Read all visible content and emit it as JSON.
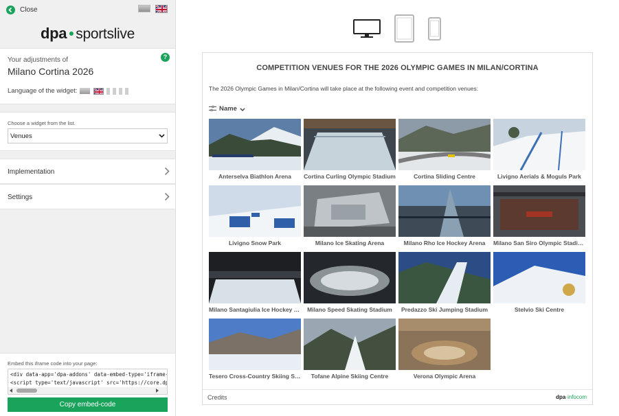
{
  "sidebar": {
    "close_label": "Close",
    "flags": [
      "flag-grey-icon",
      "flag-uk-icon"
    ],
    "logo": {
      "dpa": "dpa",
      "dot": "•",
      "brand": "sportslive"
    },
    "adjustments_label": "Your adjustments of",
    "adjustments_title": "Milano Cortina 2026",
    "help_icon": "?",
    "language_label": "Language of the widget:",
    "widget_select_label": "Choose a widget from the list.",
    "widget_select_value": "Venues",
    "accordions": [
      {
        "label": "Implementation"
      },
      {
        "label": "Settings"
      }
    ],
    "embed_label": "Embed this iframe code into your page:",
    "embed_code_lines": [
      "<div data-app='dpa-addons' data-embed-type='iframe-dyn",
      "<script type='text/javascript' src='https://core.dpa-infocom"
    ],
    "copy_button": "Copy embed-code"
  },
  "devices": [
    "desktop-icon",
    "tablet-icon",
    "phone-icon"
  ],
  "widget": {
    "title": "COMPETITION VENUES FOR THE 2026 OLYMPIC GAMES IN MILAN/CORTINA",
    "intro": "The 2026 Olympic Games in Milan/Cortina will take place at the following event and competition venues:",
    "sort_label": "Name",
    "venues": [
      {
        "name": "Anterselva Biathlon Arena"
      },
      {
        "name": "Cortina Curling Olympic Stadium"
      },
      {
        "name": "Cortina Sliding Centre"
      },
      {
        "name": "Livigno Aerials & Moguls Park"
      },
      {
        "name": "Livigno Snow Park"
      },
      {
        "name": "Milano Ice Skating Arena"
      },
      {
        "name": "Milano Rho Ice Hockey Arena"
      },
      {
        "name": "Milano San Siro Olympic Stadium"
      },
      {
        "name": "Milano Santagiulia Ice Hockey Arena"
      },
      {
        "name": "Milano Speed Skating Stadium"
      },
      {
        "name": "Predazzo Ski Jumping Stadium"
      },
      {
        "name": "Stelvio Ski Centre"
      },
      {
        "name": "Tesero Cross-Country Skiing Stadium"
      },
      {
        "name": "Tofane Alpine Skiing Centre"
      },
      {
        "name": "Verona Olympic Arena"
      }
    ],
    "credits": "Credits",
    "footer_logo": {
      "dpa": "dpa",
      "infocom": "·infocom"
    }
  },
  "colors": {
    "accent": "#1aa35a",
    "sidebar_bg": "#f0f0f0",
    "title": "#444444"
  }
}
